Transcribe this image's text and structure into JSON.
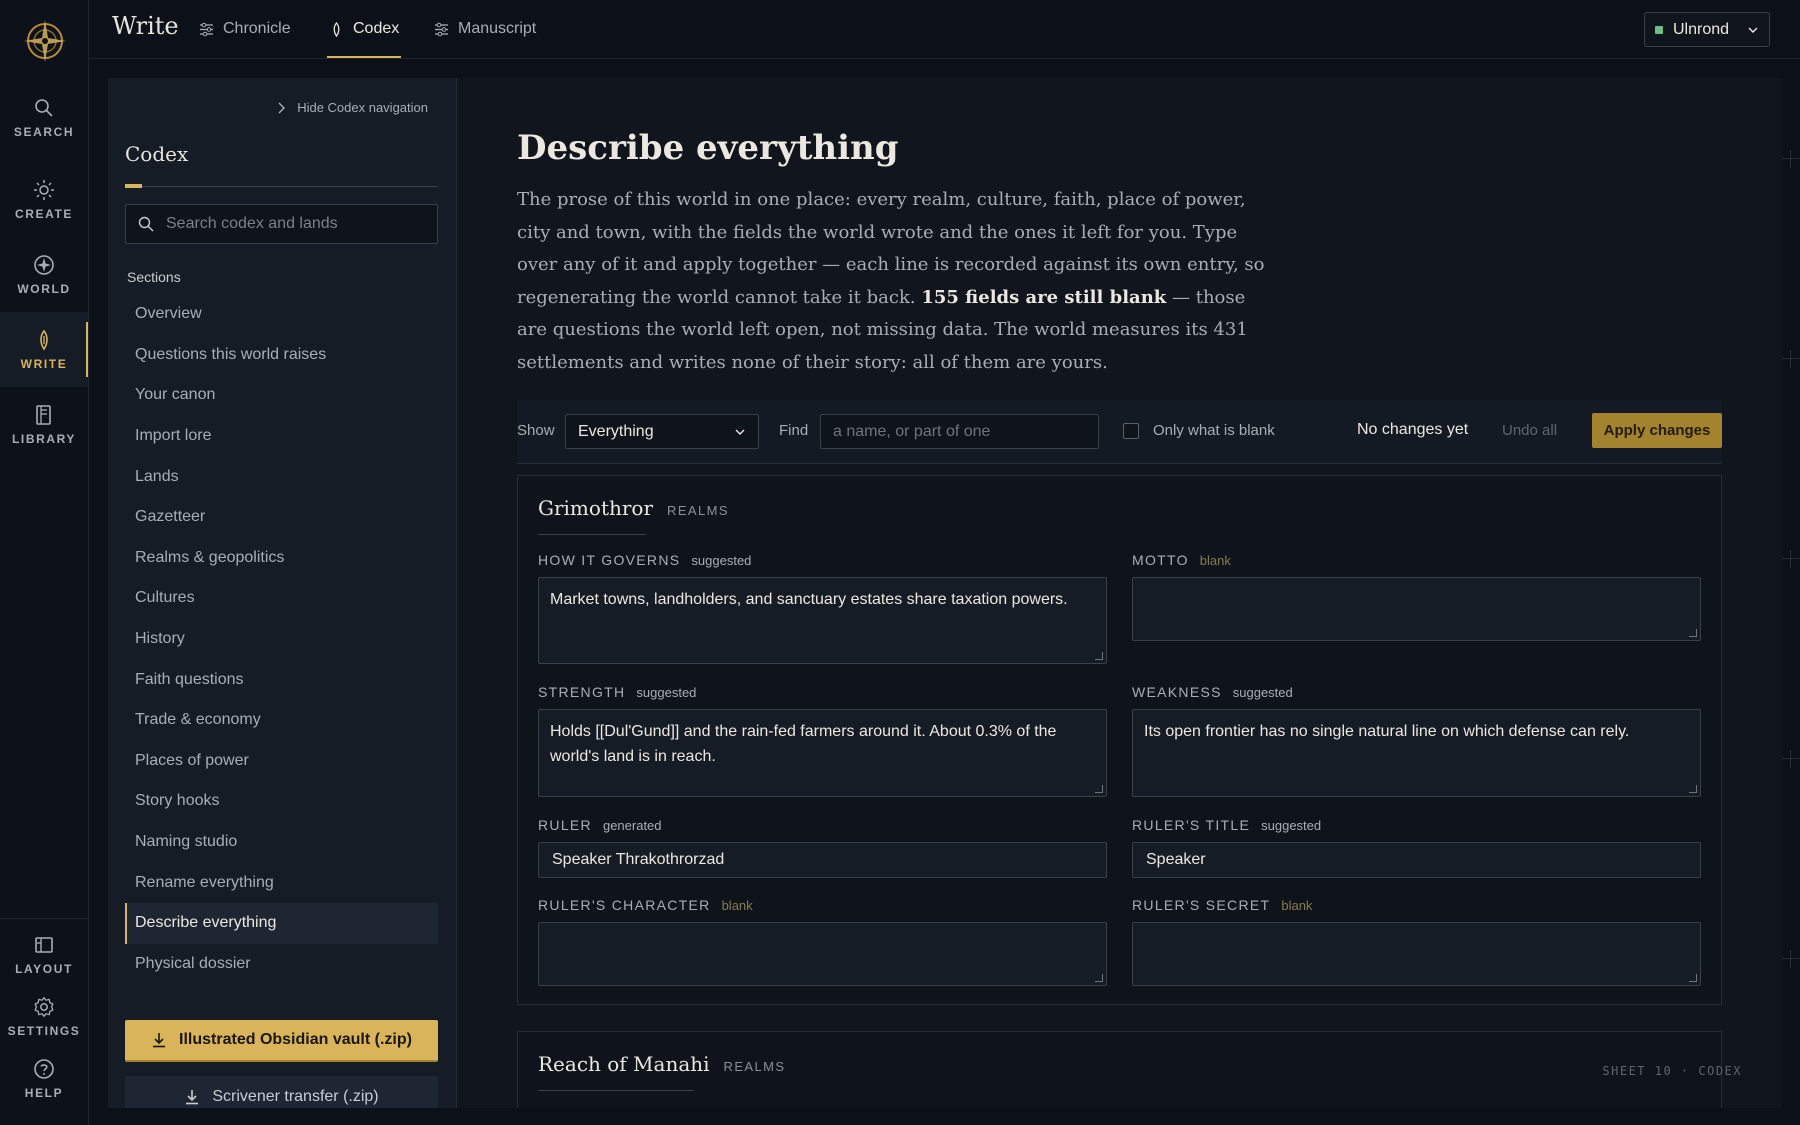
{
  "rail": {
    "items": [
      {
        "label": "SEARCH",
        "icon": "search-icon"
      },
      {
        "label": "CREATE",
        "icon": "sun-icon"
      },
      {
        "label": "WORLD",
        "icon": "compass-icon"
      },
      {
        "label": "WRITE",
        "icon": "quill-icon",
        "active": true
      },
      {
        "label": "LIBRARY",
        "icon": "book-icon"
      }
    ],
    "bottom": [
      {
        "label": "LAYOUT",
        "icon": "layout-icon"
      },
      {
        "label": "SETTINGS",
        "icon": "gear-icon"
      },
      {
        "label": "HELP",
        "icon": "help-icon"
      }
    ]
  },
  "topbar": {
    "title": "Write",
    "tabs": [
      {
        "label": "Chronicle",
        "icon": "sliders-icon"
      },
      {
        "label": "Codex",
        "icon": "quill-icon",
        "active": true
      },
      {
        "label": "Manuscript",
        "icon": "sliders-icon"
      }
    ],
    "user": "Ulnrond",
    "accent": "#d9b45a",
    "user_status_color": "#6bbf86"
  },
  "codexnav": {
    "hide_label": "Hide Codex navigation",
    "title": "Codex",
    "search_placeholder": "Search codex and lands",
    "sections_label": "Sections",
    "items": [
      "Overview",
      "Questions this world raises",
      "Your canon",
      "Import lore",
      "Lands",
      "Gazetteer",
      "Realms & geopolitics",
      "Cultures",
      "History",
      "Faith questions",
      "Trade & economy",
      "Places of power",
      "Story hooks",
      "Naming studio",
      "Rename everything",
      "Describe everything",
      "Physical dossier"
    ],
    "active_item": "Describe everything",
    "export_primary": "Illustrated Obsidian vault (.zip)",
    "export_secondary": "Scrivener transfer (.zip)"
  },
  "main": {
    "title": "Describe everything",
    "desc_before": "The prose of this world in one place: every realm, culture, faith, place of power, city and town, with the fields the world wrote and the ones it left for you. Type over any of it and apply together — each line is recorded against its own entry, so regenerating the world cannot take it back. ",
    "desc_bold": "155 fields are still blank",
    "desc_after": " — those are questions the world left open, not missing data. The world measures its 431 settlements and writes none of their story: all of them are yours.",
    "toolbar": {
      "show_label": "Show",
      "show_value": "Everything",
      "find_label": "Find",
      "find_placeholder": "a name, or part of one",
      "only_blank_label": "Only what is blank",
      "status": "No changes yet",
      "undo_label": "Undo all",
      "apply_label": "Apply changes"
    },
    "cards": [
      {
        "name": "Grimothror",
        "tag": "REALMS",
        "fields": {
          "governs": {
            "label": "HOW IT GOVERNS",
            "status": "suggested",
            "value": "Market towns, landholders, and sanctuary estates share taxation powers."
          },
          "motto": {
            "label": "MOTTO",
            "status": "blank",
            "value": ""
          },
          "strength": {
            "label": "STRENGTH",
            "status": "suggested",
            "value": "Holds [[Dul'Gund]] and the rain-fed farmers around it. About 0.3% of the world's land is in reach."
          },
          "weakness": {
            "label": "WEAKNESS",
            "status": "suggested",
            "value": "Its open frontier has no single natural line on which defense can rely."
          },
          "ruler": {
            "label": "RULER",
            "status": "generated",
            "value": "Speaker Thrakothrorzad"
          },
          "ruler_title": {
            "label": "RULER'S TITLE",
            "status": "suggested",
            "value": "Speaker"
          },
          "ruler_character": {
            "label": "RULER'S CHARACTER",
            "status": "blank",
            "value": ""
          },
          "ruler_secret": {
            "label": "RULER'S SECRET",
            "status": "blank",
            "value": ""
          }
        }
      },
      {
        "name": "Reach of Manahi",
        "tag": "REALMS"
      }
    ],
    "sheet_label": "SHEET 10 · CODEX"
  }
}
